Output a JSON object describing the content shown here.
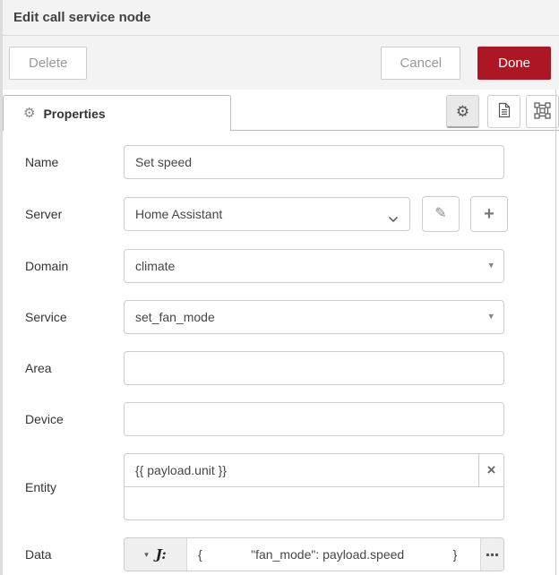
{
  "dialog": {
    "title": "Edit call service node"
  },
  "toolbar": {
    "delete": "Delete",
    "cancel": "Cancel",
    "done": "Done"
  },
  "tabs": {
    "properties": "Properties"
  },
  "icons": {
    "gear": "⚙",
    "pencil": "✎",
    "plus": "+",
    "close": "×",
    "caret_down": "▾"
  },
  "colors": {
    "accent_red": "#ad1625",
    "panel_gray": "#f3f3f3",
    "border_gray": "#cccccc"
  },
  "form": {
    "name": {
      "label": "Name",
      "value": "Set speed"
    },
    "server": {
      "label": "Server",
      "value": "Home Assistant"
    },
    "domain": {
      "label": "Domain",
      "value": "climate"
    },
    "service": {
      "label": "Service",
      "value": "set_fan_mode"
    },
    "area": {
      "label": "Area",
      "value": ""
    },
    "device": {
      "label": "Device",
      "value": ""
    },
    "entity": {
      "label": "Entity",
      "value": "{{ payload.unit }}"
    },
    "data": {
      "label": "Data",
      "type_label": "J:",
      "value": "{              \"fan_mode\": payload.speed              }"
    }
  }
}
